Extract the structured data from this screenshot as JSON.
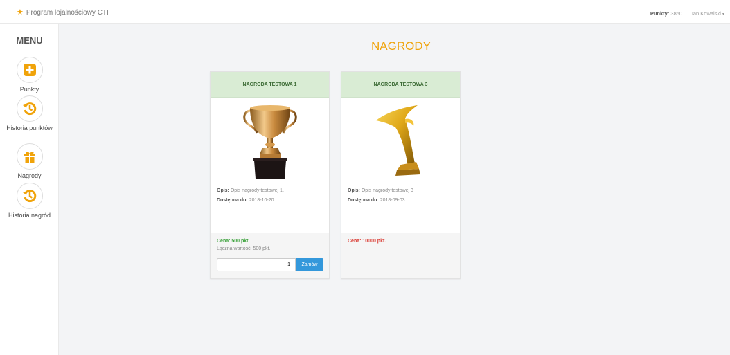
{
  "navbar": {
    "brand": "Program lojalnościowy CTI",
    "points_label": "Punkty:",
    "points_value": "3850",
    "user": "Jan Kowalski",
    "caret": "▾"
  },
  "sidebar": {
    "title": "MENU",
    "items": [
      {
        "label": "Punkty",
        "icon": "plus-square-icon"
      },
      {
        "label": "Historia punktów",
        "icon": "history-icon"
      },
      {
        "label": "Nagrody",
        "icon": "gift-icon"
      },
      {
        "label": "Historia nagród",
        "icon": "history-icon"
      }
    ]
  },
  "main": {
    "title": "NAGRODY",
    "cards": [
      {
        "title": "NAGRODA TESTOWA 1",
        "image": "trophy-cup-image",
        "desc_label": "Opis:",
        "desc": "Opis nagrody testowej 1.",
        "avail_label": "Dostępna do:",
        "avail": "2018-10-20",
        "price": "Cena: 500 pkt.",
        "total": "Łączna wartość: 500 pkt.",
        "qty": "1",
        "order_label": "Zamów"
      },
      {
        "title": "NAGRODA TESTOWA 3",
        "image": "gold-statuette-image",
        "desc_label": "Opis:",
        "desc": "Opis nagrody testowej 3",
        "avail_label": "Dostępna do:",
        "avail": "2018-09-03",
        "price": "Cena: 10000 pkt."
      }
    ]
  },
  "colors": {
    "accent": "#f0a30a",
    "header_green": "#d9ecd4",
    "price_ok": "#3aa13a",
    "price_bad": "#d9342b",
    "button": "#3498db"
  }
}
